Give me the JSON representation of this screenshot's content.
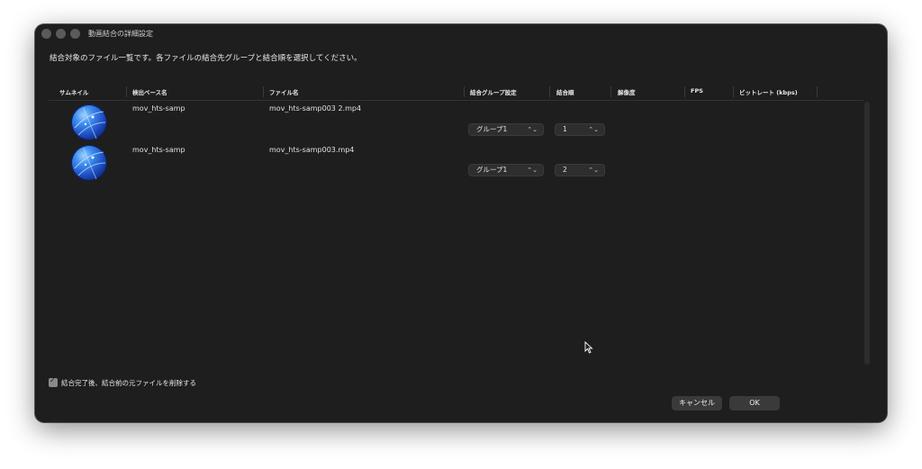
{
  "window": {
    "title": "動画結合の詳細設定"
  },
  "instruction": "結合対象のファイル一覧です。各ファイルの結合先グループと結合順を選択してください。",
  "table": {
    "headers": [
      "サムネイル",
      "検出ベース名",
      "ファイル名",
      "結合グループ設定",
      "結合順",
      "解像度",
      "FPS",
      "ビットレート (kbps)"
    ],
    "rows": [
      {
        "base_name": "mov_hts-samp",
        "file_name": "mov_hts-samp003 2.mp4",
        "group": "グループ1",
        "order": "1",
        "resolution": "",
        "fps": "",
        "bitrate": ""
      },
      {
        "base_name": "mov_hts-samp",
        "file_name": "mov_hts-samp003.mp4",
        "group": "グループ1",
        "order": "2",
        "resolution": "",
        "fps": "",
        "bitrate": ""
      }
    ]
  },
  "delete_after_merge": {
    "label": "結合完了後、結合前の元ファイルを削除する",
    "checked": true
  },
  "buttons": {
    "cancel": "キャンセル",
    "ok": "OK"
  },
  "icons": {
    "select_chevron": "⌃⌄",
    "checkbox_check": "✓"
  },
  "colors": {
    "window_bg": "#1e1e1e",
    "text": "#e6e6e6",
    "control_bg": "#2e2e2e"
  }
}
